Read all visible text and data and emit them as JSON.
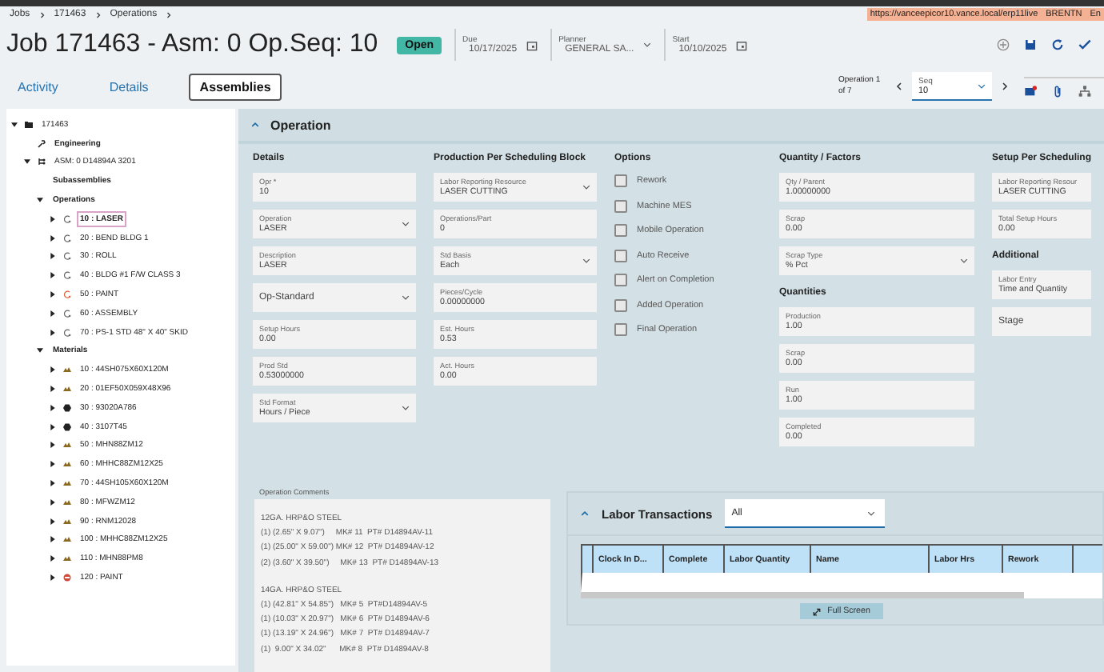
{
  "breadcrumb": [
    "Jobs",
    "171463",
    "Operations"
  ],
  "url_bar": {
    "url": "https://vanceepicor10.vance.local/erp11live",
    "user": "BRENTN",
    "language": "En"
  },
  "header": {
    "title": "Job 171463 - Asm: 0 Op.Seq: 10",
    "status": "Open",
    "due": {
      "label": "Due",
      "value": "10/17/2025"
    },
    "planner": {
      "label": "Planner",
      "value": "GENERAL SA..."
    },
    "start": {
      "label": "Start",
      "value": "10/10/2025"
    }
  },
  "tabs": [
    {
      "label": "Activity",
      "selected": false
    },
    {
      "label": "Details",
      "selected": false
    },
    {
      "label": "Assemblies",
      "selected": true
    }
  ],
  "navigator": {
    "position": "Operation 1 of 7",
    "seq_label": "Seq",
    "seq_value": "10"
  },
  "tree": [
    {
      "label": "171463",
      "kind": "job",
      "selected": false,
      "expanded": true,
      "children": [
        {
          "label": "Engineering",
          "kind": "engineering",
          "selected": false
        },
        {
          "label": "ASM: 0 D14894A 3201",
          "kind": "assembly",
          "selected": false,
          "expanded": true,
          "children": [
            {
              "label": "Subassemblies",
              "kind": "group",
              "selected": false
            },
            {
              "label": "Operations",
              "kind": "group",
              "selected": false,
              "expanded": true,
              "children": [
                {
                  "label": "10 : LASER",
                  "kind": "operation",
                  "selected": true,
                  "expanded": false
                },
                {
                  "label": "20 : BEND BLDG 1",
                  "kind": "operation",
                  "selected": false,
                  "expanded": false
                },
                {
                  "label": "30 : ROLL",
                  "kind": "operation",
                  "selected": false,
                  "expanded": false
                },
                {
                  "label": "40 : BLDG #1 F/W CLASS 3",
                  "kind": "operation",
                  "selected": false,
                  "expanded": false
                },
                {
                  "label": "50 : PAINT",
                  "kind": "subcontract",
                  "selected": false,
                  "expanded": false
                },
                {
                  "label": "60 : ASSEMBLY",
                  "kind": "operation",
                  "selected": false,
                  "expanded": false
                },
                {
                  "label": "70 : PS-1 STD 48\" X 40\" SKID",
                  "kind": "operation",
                  "selected": false,
                  "expanded": false
                }
              ]
            },
            {
              "label": "Materials",
              "kind": "group",
              "selected": false,
              "expanded": true,
              "children": [
                {
                  "label": "10 : 44SH075X60X120M",
                  "kind": "material",
                  "selected": false,
                  "expanded": false
                },
                {
                  "label": "20 : 01EF50X059X48X96",
                  "kind": "material",
                  "selected": false,
                  "expanded": false
                },
                {
                  "label": "30 : 93020A786",
                  "kind": "hardware",
                  "selected": false,
                  "expanded": false
                },
                {
                  "label": "40 : 3107T45",
                  "kind": "hardware",
                  "selected": false,
                  "expanded": false
                },
                {
                  "label": "50 : MHN88ZM12",
                  "kind": "material",
                  "selected": false,
                  "expanded": false
                },
                {
                  "label": "60 : MHHC88ZM12X25",
                  "kind": "material",
                  "selected": false,
                  "expanded": false
                },
                {
                  "label": "70 : 44SH105X60X120M",
                  "kind": "material",
                  "selected": false,
                  "expanded": false
                },
                {
                  "label": "80 : MFWZM12",
                  "kind": "material",
                  "selected": false,
                  "expanded": false
                },
                {
                  "label": "90 : RNM12028",
                  "kind": "material",
                  "selected": false,
                  "expanded": false
                },
                {
                  "label": "100 : MHHC88ZM12X25",
                  "kind": "material",
                  "selected": false,
                  "expanded": false
                },
                {
                  "label": "110 : MHN88PM8",
                  "kind": "material",
                  "selected": false,
                  "expanded": false
                },
                {
                  "label": "120 : PAINT",
                  "kind": "paint",
                  "selected": false,
                  "expanded": false
                }
              ]
            }
          ]
        }
      ]
    }
  ],
  "operation": {
    "title": "Operation",
    "expanded": true,
    "columns": [
      {
        "heading": "Details",
        "items": [
          {
            "kind": "field",
            "label": "Opr *",
            "value": "10",
            "dropdown": false
          },
          {
            "kind": "field",
            "label": "Operation",
            "value": "LASER",
            "dropdown": true
          },
          {
            "kind": "field",
            "label": "Description",
            "value": "LASER",
            "dropdown": false
          },
          {
            "kind": "select",
            "label": "Op-Standard",
            "dropdown": true
          },
          {
            "kind": "field",
            "label": "Setup Hours",
            "value": "0.00",
            "dropdown": false
          },
          {
            "kind": "field",
            "label": "Prod Std",
            "value": "0.53000000",
            "dropdown": false
          },
          {
            "kind": "field",
            "label": "Std Format",
            "value": "Hours / Piece",
            "dropdown": true
          }
        ]
      },
      {
        "heading": "Production Per Scheduling Block",
        "items": [
          {
            "kind": "field",
            "label": "Labor Reporting Resource",
            "value": "LASER CUTTING",
            "dropdown": true
          },
          {
            "kind": "field",
            "label": "Operations/Part",
            "value": "0",
            "dropdown": false
          },
          {
            "kind": "field",
            "label": "Std Basis",
            "value": "Each",
            "dropdown": true
          },
          {
            "kind": "field",
            "label": "Pieces/Cycle",
            "value": "0.00000000",
            "dropdown": false
          },
          {
            "kind": "field",
            "label": "Est. Hours",
            "value": "0.53",
            "dropdown": false
          },
          {
            "kind": "field",
            "label": "Act. Hours",
            "value": "0.00",
            "dropdown": false
          }
        ]
      },
      {
        "heading": "Options",
        "items": [
          {
            "kind": "checkbox",
            "label": "Rework",
            "checked": false
          },
          {
            "kind": "checkbox",
            "label": "Machine MES",
            "checked": false
          },
          {
            "kind": "checkbox",
            "label": "Mobile Operation",
            "checked": false
          },
          {
            "kind": "checkbox",
            "label": "Auto Receive",
            "checked": false
          },
          {
            "kind": "checkbox",
            "label": "Alert on Completion",
            "checked": false
          },
          {
            "kind": "checkbox",
            "label": "Added Operation",
            "checked": false
          },
          {
            "kind": "checkbox",
            "label": "Final Operation",
            "checked": false
          }
        ]
      },
      {
        "heading": "Quantity / Factors",
        "items": [
          {
            "kind": "field",
            "label": "Qty / Parent",
            "value": "1.00000000",
            "dropdown": false
          },
          {
            "kind": "field",
            "label": "Scrap",
            "value": "0.00",
            "dropdown": false
          },
          {
            "kind": "field",
            "label": "Scrap Type",
            "value": "% Pct",
            "dropdown": true
          },
          {
            "kind": "heading",
            "label": "Quantities"
          },
          {
            "kind": "field",
            "label": "Production",
            "value": "1.00",
            "dropdown": false
          },
          {
            "kind": "field",
            "label": "Scrap",
            "value": "0.00",
            "dropdown": false
          },
          {
            "kind": "field",
            "label": "Run",
            "value": "1.00",
            "dropdown": false
          },
          {
            "kind": "field",
            "label": "Completed",
            "value": "0.00",
            "dropdown": false
          }
        ]
      },
      {
        "heading": "Setup Per Scheduling",
        "items": [
          {
            "kind": "field",
            "label": "Labor Reporting Resour",
            "value": "LASER CUTTING",
            "dropdown": false
          },
          {
            "kind": "field",
            "label": "Total Setup Hours",
            "value": "0.00",
            "dropdown": false
          },
          {
            "kind": "heading",
            "label": "Additional"
          },
          {
            "kind": "field",
            "label": "Labor Entry",
            "value": "Time and Quantity",
            "dropdown": false
          },
          {
            "kind": "select",
            "label": "Stage",
            "dropdown": false
          }
        ]
      }
    ],
    "comments": {
      "label": "Operation Comments",
      "paragraphs": [
        [
          "12GA. HRP&O STEEL",
          "(1) (2.65\" X 9.07\")     MK# 11  PT# D14894AV-11",
          "(1) (25.00\" X 59.00\") MK# 12  PT# D14894AV-12",
          "(2) (3.60\" X 39.50\")     MK# 13  PT# D14894AV-13"
        ],
        [
          "14GA. HRP&O STEEL",
          "(1) (42.81\" X 54.85\")   MK# 5  PT#D14894AV-5",
          "(1) (10.03\" X 20.97\")   MK# 6  PT# D14894AV-6",
          "(1) (13.19\" X 24.96\")   MK# 7  PT# D14894AV-7",
          "(1)  9.00\" X 34.02\"      MK# 8  PT# D14894AV-8"
        ]
      ]
    }
  },
  "labor": {
    "title": "Labor Transactions",
    "expanded": true,
    "filter": "All",
    "columns": [
      "Clock In D...",
      "Complete",
      "Labor Quantity",
      "Name",
      "Labor Hrs",
      "Rework"
    ],
    "full_screen": "Full Screen"
  }
}
